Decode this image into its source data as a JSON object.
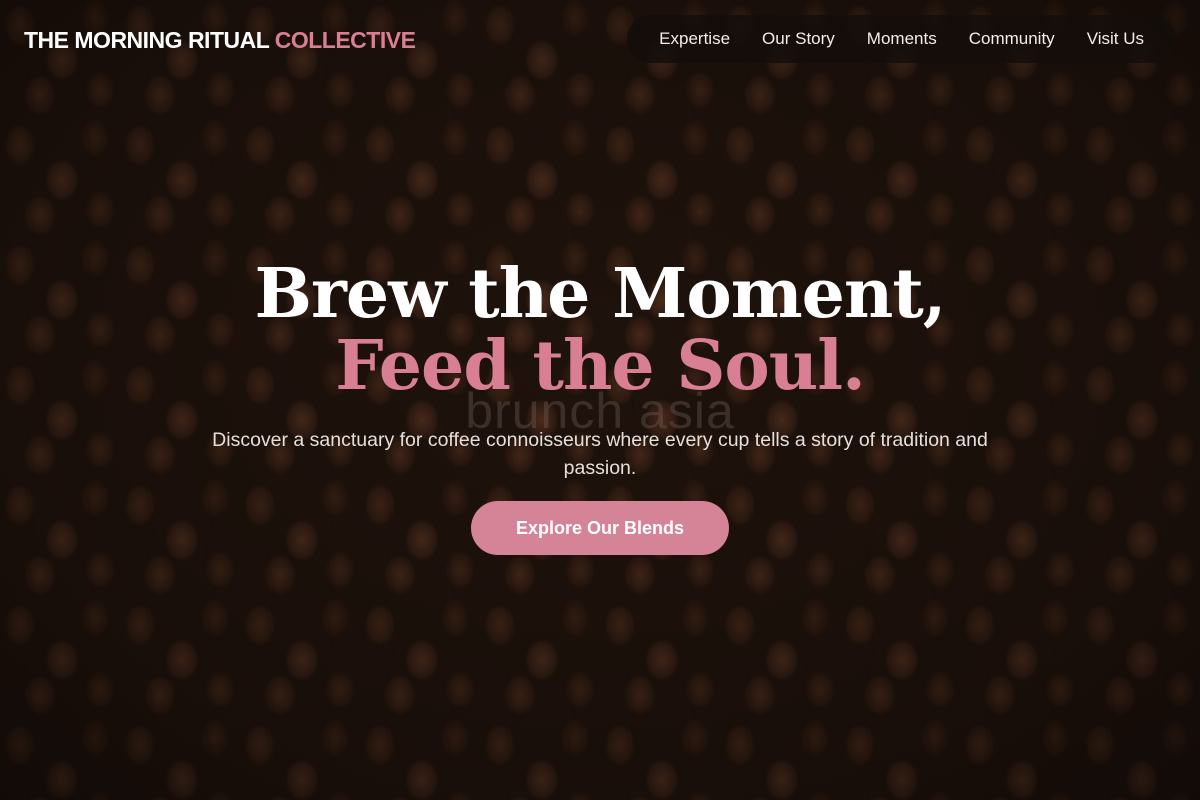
{
  "brand": {
    "name_main": "THE MORNING RITUAL",
    "name_accent": "COLLECTIVE",
    "accent_color": "#d87f93"
  },
  "nav": {
    "items": [
      {
        "label": "Expertise"
      },
      {
        "label": "Our Story"
      },
      {
        "label": "Moments"
      },
      {
        "label": "Community"
      },
      {
        "label": "Visit Us"
      }
    ]
  },
  "hero": {
    "headline_line1": "Brew the Moment,",
    "headline_line2": "Feed the Soul.",
    "watermark": "brunch asia",
    "subtitle": "Discover a sanctuary for coffee connoisseurs where every cup tells a story of tradition and passion.",
    "cta_label": "Explore Our Blends",
    "cta_color": "#d58396"
  }
}
